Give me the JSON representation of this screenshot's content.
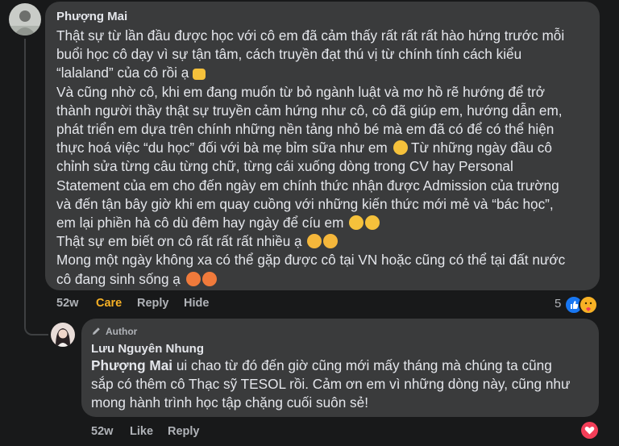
{
  "comment1": {
    "author": "Phượng Mai",
    "lines": [
      "Thật sự từ lần đầu được học với cô em đã cảm thấy rất rất rất hào hứng trước mỗi",
      "buổi học cô dạy vì sự tận tâm, cách truyền đạt thú vị từ chính tính cách kiểu",
      "“lalaland” của cô rồi ạ",
      "Và cũng nhờ cô, khi em đang muốn từ bỏ ngành luật và mơ hồ rẽ hướng để trở",
      "thành người thầy thật sự truyền cảm hứng như cô, cô đã giúp em, hướng dẫn em,",
      "phát triển em dựa trên chính những nền tảng nhỏ bé mà em đã có để có thể hiện",
      "thực hoá việc “du học” đối với bà mẹ bỉm sữa như em",
      "chỉnh sửa từng câu từng chữ, từng cái xuống dòng trong CV hay Personal",
      "Statement của em cho đến ngày em chính thức nhận được Admission của trường",
      "và đến tận bây giờ khi em quay cuồng với những kiến thức mới mẻ và “bác học”,",
      "em lại phiền hà cô dù đêm hay ngày để cíu em",
      "Thật sự em biết ơn cô rất rất rất nhiều ạ",
      "Mong một ngày không xa có thể gặp được cô tại VN hoặc cũng có thể tại đất nước",
      "cô đang sinh sống ạ"
    ],
    "line7_tail": "Từ những ngày đầu cô",
    "time": "52w",
    "reaction_label": "Care",
    "reply_label": "Reply",
    "hide_label": "Hide",
    "reaction_count": "5"
  },
  "comment2": {
    "badge": "Author",
    "author": "Lưu Nguyên Nhung",
    "mention": "Phượng Mai",
    "line1_rest": " ui chao từ đó đến giờ cũng mới mấy tháng mà chúng ta cũng",
    "line2": "sắp có thêm cô Thạc sỹ TESOL rồi. Cảm ơn em vì những dòng này, cũng như",
    "line3": "mong hành trình học tập chặng cuối suôn sẻ!",
    "time": "52w",
    "like_label": "Like",
    "reply_label": "Reply"
  },
  "colors": {
    "background": "#18191a",
    "bubble": "#3a3b3c",
    "care": "#f7b125",
    "like": "#1877f2",
    "love": "#f33e58"
  }
}
